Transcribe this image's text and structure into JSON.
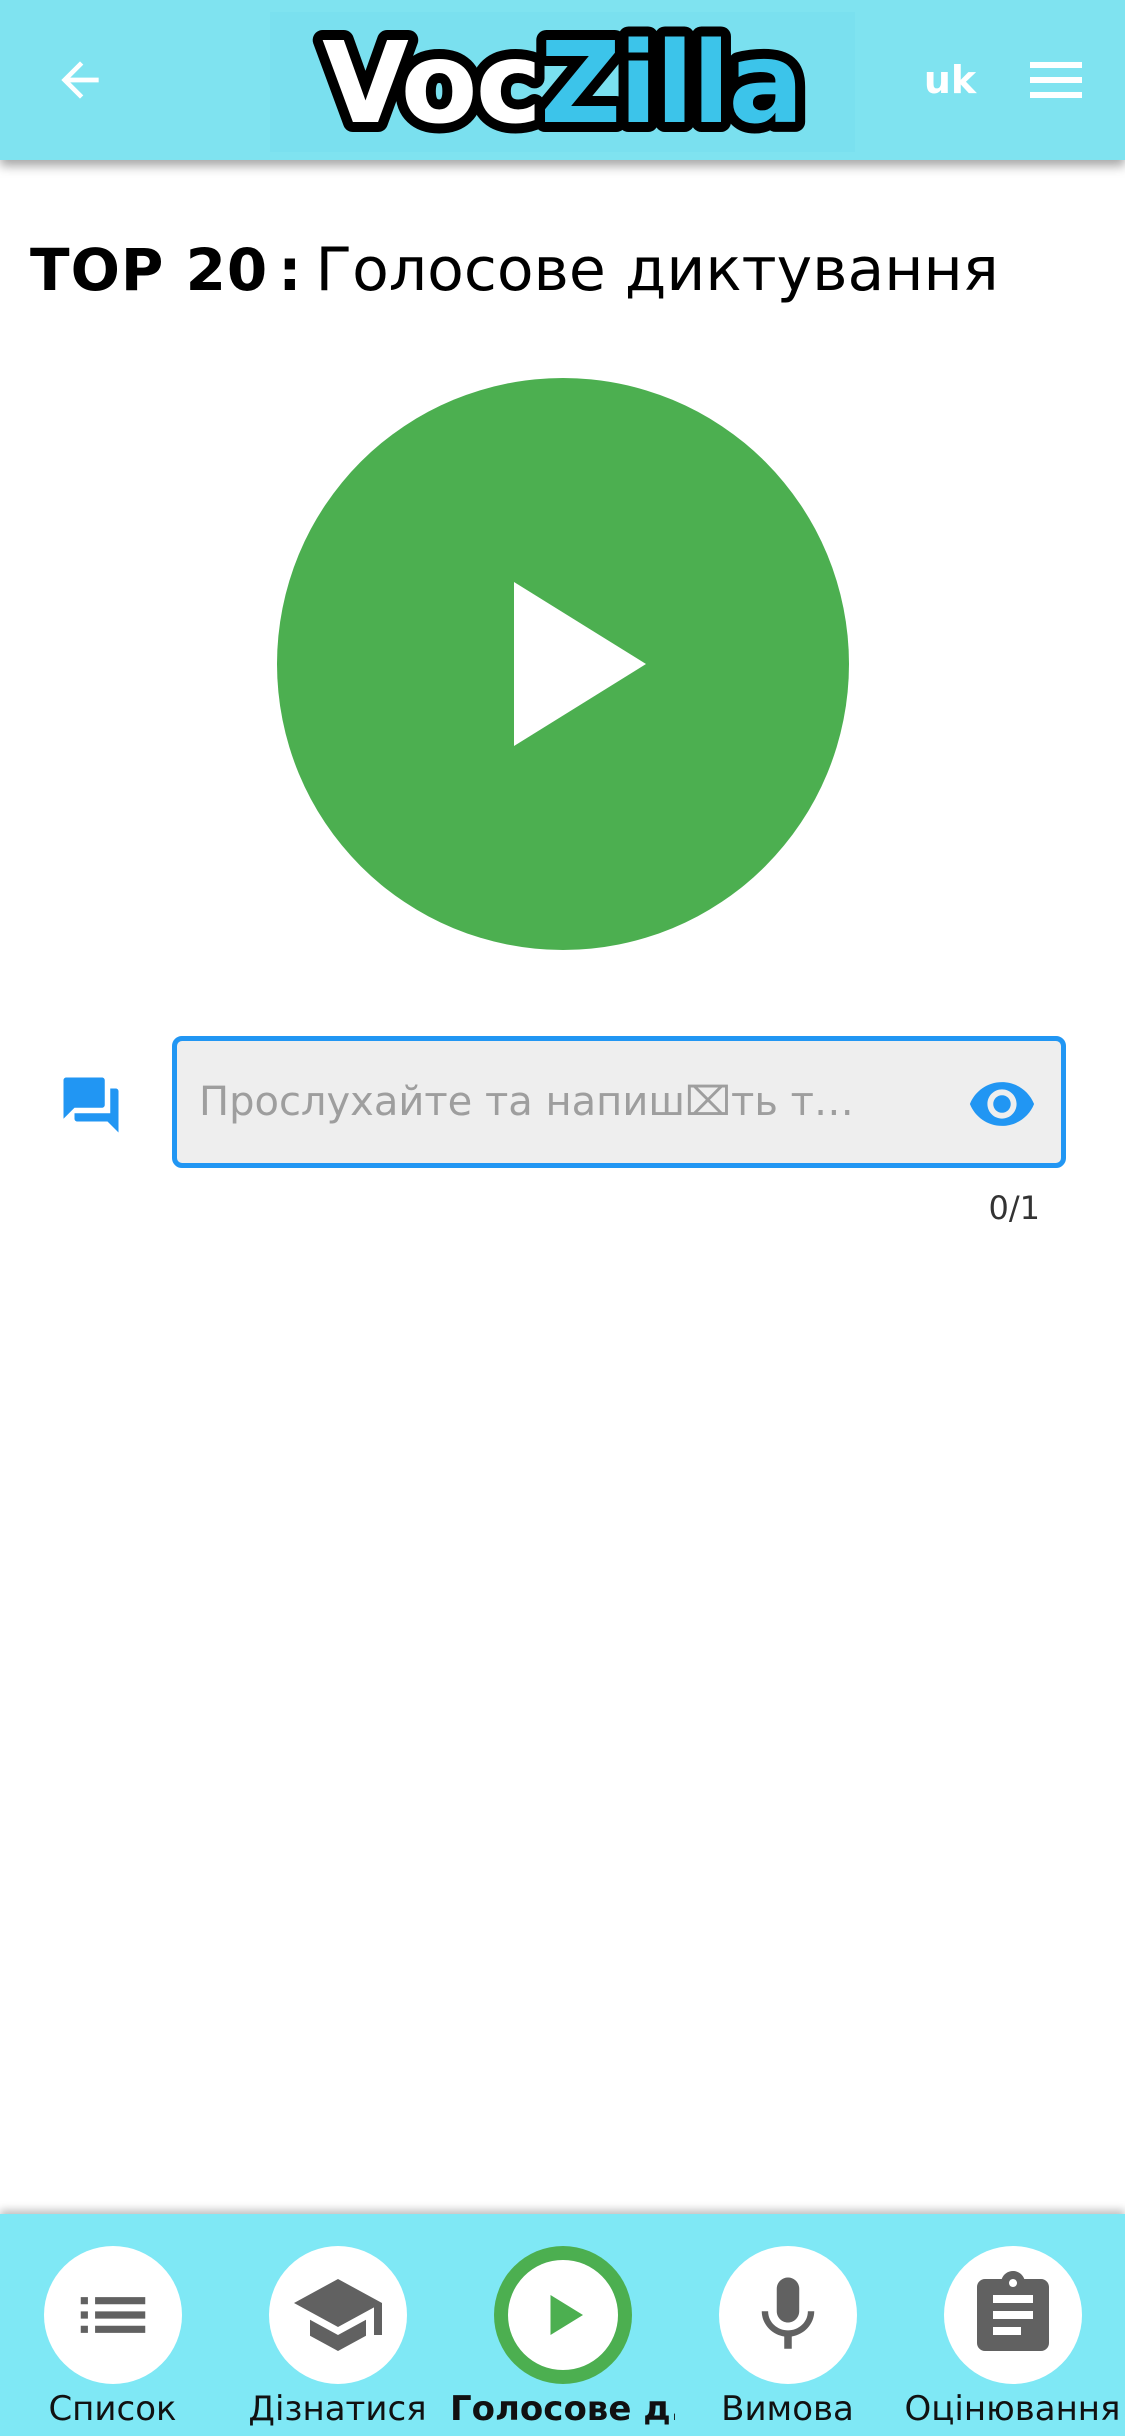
{
  "header": {
    "logo_text_voc": "Voc",
    "logo_text_zilla": "Zilla",
    "language": "uk",
    "icons": {
      "back": "arrow-left-icon",
      "menu": "hamburger-menu-icon"
    }
  },
  "title": {
    "top": "TOP 20",
    "separator": ":",
    "main": "Голосове диктування"
  },
  "player": {
    "icon": "play-icon",
    "color": "#4caf50"
  },
  "answer": {
    "placeholder": "Прослухайте та напиш⌧ть т…",
    "value": "",
    "counter": "0/1",
    "icons": {
      "chat": "chat-icon",
      "reveal": "eye-icon"
    },
    "accent": "#2196f3"
  },
  "bottom_nav": {
    "items": [
      {
        "label": "Список",
        "icon": "list-icon",
        "active": false
      },
      {
        "label": "Дізнатися",
        "icon": "graduation-cap-icon",
        "active": false
      },
      {
        "label": "Голосове д...",
        "icon": "play-icon",
        "active": true
      },
      {
        "label": "Вимова",
        "icon": "microphone-icon",
        "active": false
      },
      {
        "label": "Оцінювання",
        "icon": "clipboard-icon",
        "active": false
      }
    ]
  },
  "colors": {
    "header_bg": "#7fe3f0",
    "nav_bg": "#7fe8f5",
    "active": "#4caf50"
  }
}
